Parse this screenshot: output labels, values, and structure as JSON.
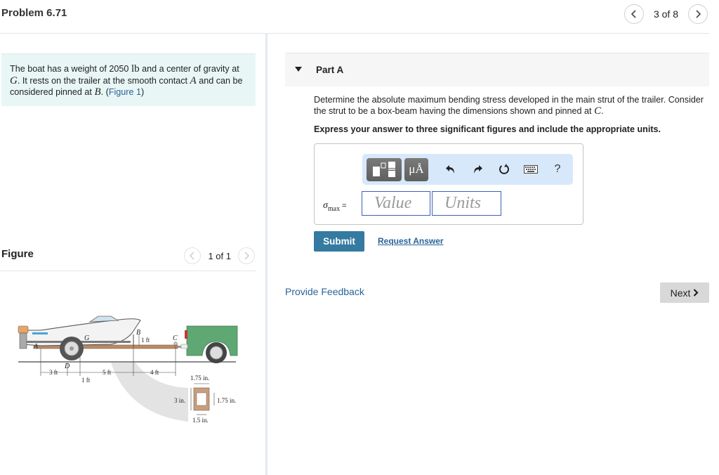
{
  "header": {
    "problem_title": "Problem 6.71",
    "pager_text": "3 of 8",
    "prev_icon": "chevron-left-icon",
    "next_icon": "chevron-right-icon"
  },
  "intro": {
    "text_1": "The boat has a weight of 2050 ",
    "unit_lb": "lb",
    "text_2": " and a center of gravity at ",
    "var_G": "G",
    "text_3": ". It rests on the trailer at the smooth contact ",
    "var_A": "A",
    "text_4": " and can be considered pinned at ",
    "var_B": "B",
    "text_5": ". (",
    "figure_link": "Figure 1",
    "text_6": ")"
  },
  "figure_panel": {
    "title": "Figure",
    "pager_text": "1 of 1",
    "labels": {
      "A": "A",
      "B": "B",
      "C": "C",
      "D": "D",
      "G": "G",
      "dim_3ft": "3 ft",
      "dim_1ft_low": "1 ft",
      "dim_5ft": "5 ft",
      "dim_4ft": "4 ft",
      "dim_1ft_B": "1 ft",
      "cs_top": "1.75 in.",
      "cs_height": "3 in.",
      "cs_inner": "1.75 in.",
      "cs_bottom": "1.5 in."
    },
    "colors": {
      "truck": "#5fa873",
      "trailer_bar": "#b98b66",
      "boat_hull": "#f2f2f2",
      "strut_section": "#c79e80"
    }
  },
  "part": {
    "title": "Part A",
    "question_1": "Determine the absolute maximum bending stress developed in the main strut of the trailer. Consider the strut to be a box-beam having the dimensions shown and pinned at ",
    "var_C": "C",
    "question_2": ".",
    "instruction": "Express your answer to three significant figures and include the appropriate units."
  },
  "answer": {
    "toolbar": {
      "templates_icon": "templates-icon",
      "units_label": "μÅ",
      "undo_icon": "undo-icon",
      "redo_icon": "redo-icon",
      "reset_icon": "reset-icon",
      "keyboard_icon": "keyboard-icon",
      "help_label": "?"
    },
    "variable_symbol": "σ",
    "variable_subscript": "max",
    "equals": "=",
    "value_placeholder": "Value",
    "units_placeholder": "Units"
  },
  "actions": {
    "submit": "Submit",
    "request_answer": "Request Answer",
    "provide_feedback": "Provide Feedback",
    "next": "Next"
  },
  "colors": {
    "link": "#2a6496",
    "submit_bg": "#347aa1",
    "intro_bg": "#e9f6f6",
    "toolbar_bg": "#d7e8fb",
    "input_border": "#3b62b5",
    "next_bg": "#d8d8d8"
  }
}
